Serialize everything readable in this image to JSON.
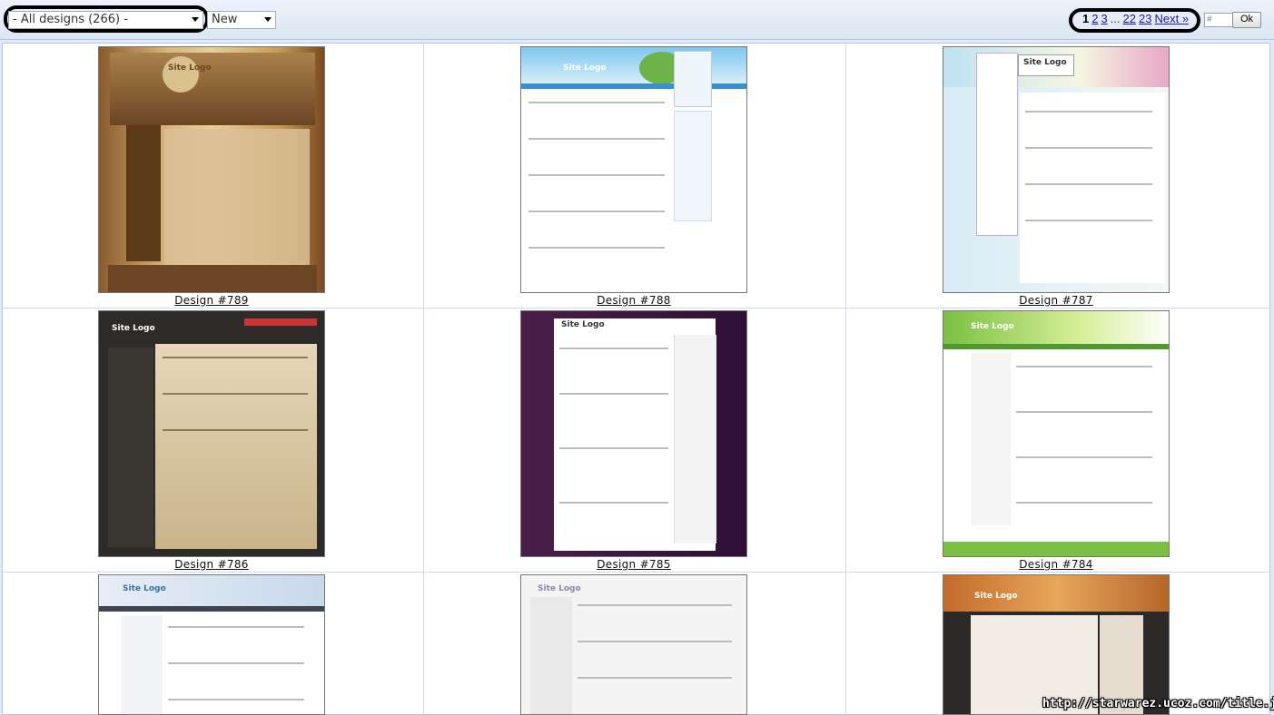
{
  "filter": {
    "category_value": "- All designs (266) -",
    "sort_value": "New"
  },
  "pager": {
    "current": "1",
    "pages": [
      "2",
      "3"
    ],
    "ellipsis": "...",
    "last_pages": [
      "22",
      "23"
    ],
    "next_label": "Next »",
    "input_placeholder": "#",
    "ok_label": "Ok"
  },
  "designs": [
    {
      "caption": "Design #789",
      "logo": "Site Logo"
    },
    {
      "caption": "Design #788",
      "logo": "Site Logo"
    },
    {
      "caption": "Design #787",
      "logo": "Site Logo"
    },
    {
      "caption": "Design #786",
      "logo": "Site Logo"
    },
    {
      "caption": "Design #785",
      "logo": "Site Logo"
    },
    {
      "caption": "Design #784",
      "logo": "Site Logo"
    },
    {
      "caption": "",
      "logo": "Site Logo"
    },
    {
      "caption": "",
      "logo": "Site Logo"
    },
    {
      "caption": "",
      "logo": "Site Logo"
    }
  ],
  "watermark": "http://starwarez.ucoz.com/title.jpg",
  "colors": {
    "toolbar_bg": "#dbe5f3",
    "link": "#1a1aa6",
    "grid_line": "#cfd9ea"
  }
}
